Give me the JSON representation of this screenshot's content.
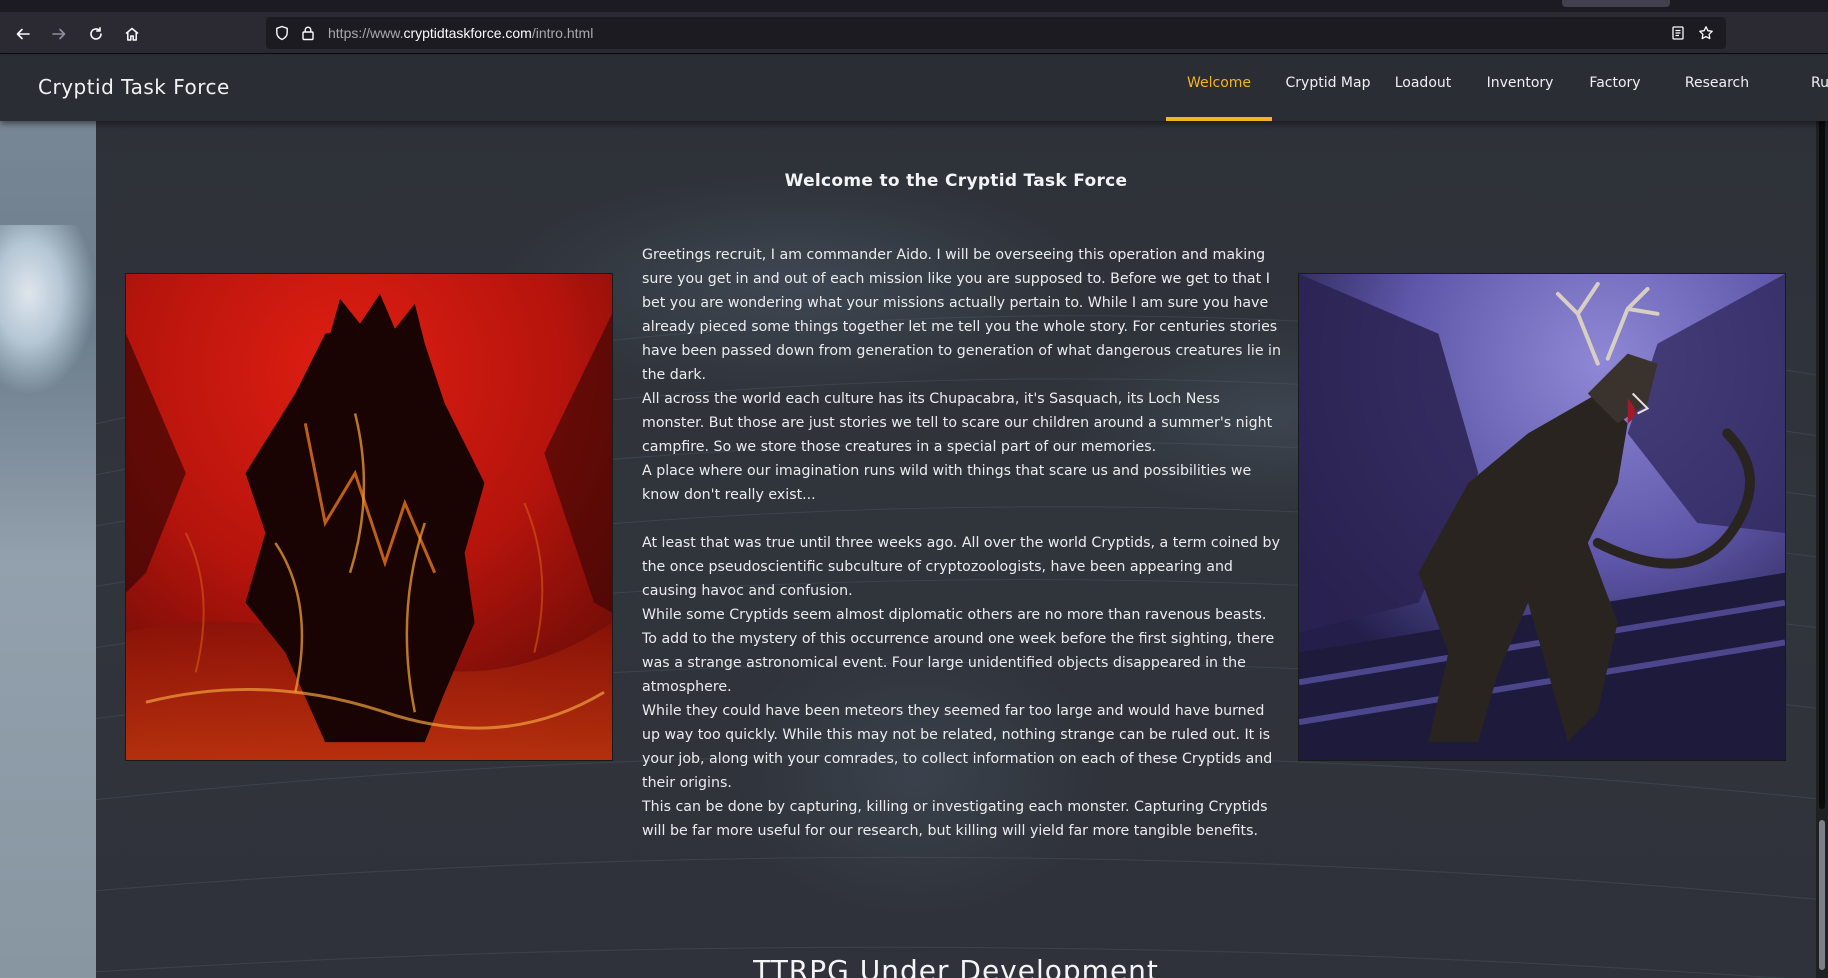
{
  "browser": {
    "url_prefix": "https://www.",
    "url_host": "cryptidtaskforce.com",
    "url_path": "/intro.html",
    "icons": [
      "back-icon",
      "forward-icon",
      "reload-icon",
      "home-icon",
      "shield-icon",
      "lock-icon",
      "reader-view-icon",
      "bookmark-star-icon"
    ]
  },
  "site": {
    "brand": "Cryptid Task Force",
    "nav": [
      {
        "label": "Welcome",
        "active": true
      },
      {
        "label": "Cryptid Map",
        "active": false
      },
      {
        "label": "Loadout",
        "active": false
      },
      {
        "label": "Inventory",
        "active": false
      },
      {
        "label": "Factory",
        "active": false
      },
      {
        "label": "Research",
        "active": false
      },
      {
        "label": "Ru",
        "active": false
      }
    ],
    "accent_color": "#f5b41e"
  },
  "main": {
    "headline": "Welcome to the Cryptid Task Force",
    "paragraphs": [
      "Greetings recruit, I am commander Aido. I will be overseeing this operation and making sure you get in and out of each mission like you are supposed to. Before we get to that I bet you are wondering what your missions actually pertain to. While I am sure you have already pieced some things together let me tell you the whole story. For centuries stories have been passed down from generation to generation of what dangerous creatures lie in the dark.",
      "All across the world each culture has its Chupacabra, it's Sasquach, its Loch Ness monster. But those are just stories we tell to scare our children around a summer's night campfire. So we store those creatures in a special part of our memories.",
      "A place where our imagination runs wild with things that scare us and possibilities we know don't really exist...",
      "",
      "At least that was true until three weeks ago. All over the world Cryptids, a term coined by the once pseudoscientific subculture of cryptozoologists, have been appearing and causing havoc and confusion.",
      "While some Cryptids seem almost diplomatic others are no more than ravenous beasts. To add to the mystery of this occurrence around one week before the first sighting, there was a strange astronomical event. Four large unidentified objects disappeared in the atmosphere.",
      "While they could have been meteors they seemed far too large and would have burned up way too quickly. While this may not be related, nothing strange can be ruled out. It is your job, along with your comrades, to collect information on each of these Cryptids and their origins.",
      "This can be done by capturing, killing or investigating each monster. Capturing Cryptids will be far more useful for our research, but killing will yield far more tangible benefits."
    ],
    "bottom_heading": "TTRPG Under Development"
  }
}
